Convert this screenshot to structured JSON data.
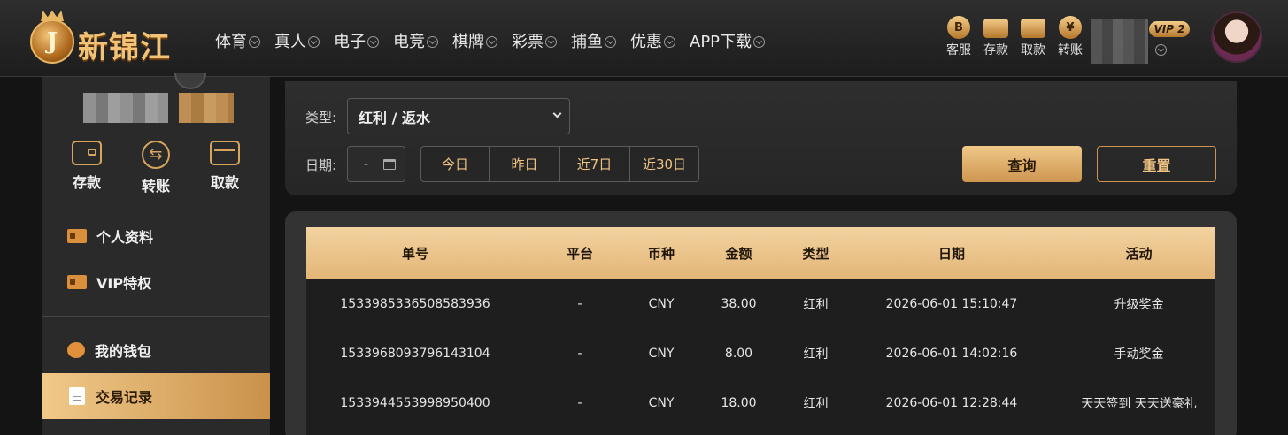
{
  "header": {
    "logo_text": "新锦江",
    "logo_letter": "J",
    "nav": [
      "体育",
      "真人",
      "电子",
      "电竞",
      "棋牌",
      "彩票",
      "捕鱼",
      "优惠",
      "APP下载"
    ],
    "quick_actions": [
      {
        "label": "客服",
        "icon": "customer-service-icon",
        "glyph": "B"
      },
      {
        "label": "存款",
        "icon": "wallet-icon",
        "glyph": ""
      },
      {
        "label": "取款",
        "icon": "withdraw-icon",
        "glyph": ""
      },
      {
        "label": "转账",
        "icon": "transfer-icon",
        "glyph": "¥"
      }
    ],
    "vip": "VIP 2"
  },
  "sidebar": {
    "actions": [
      {
        "label": "存款",
        "icon": "wallet-icon"
      },
      {
        "label": "转账",
        "icon": "transfer-icon"
      },
      {
        "label": "取款",
        "icon": "card-icon"
      }
    ],
    "menu_top": [
      "个人资料",
      "VIP特权"
    ],
    "menu_bottom": [
      "我的钱包",
      "交易记录"
    ],
    "active": "交易记录"
  },
  "filter": {
    "type_label": "类型:",
    "type_value": "红利 / 返水",
    "date_label": "日期:",
    "date_sep": "-",
    "quick_dates": [
      "今日",
      "昨日",
      "近7日",
      "近30日"
    ],
    "query_btn": "查询",
    "reset_btn": "重置"
  },
  "table": {
    "headers": [
      "单号",
      "平台",
      "币种",
      "金额",
      "类型",
      "日期",
      "活动"
    ],
    "rows": [
      [
        "1533985336508583936",
        "-",
        "CNY",
        "38.00",
        "红利",
        "2026-06-01 15:10:47",
        "升级奖金"
      ],
      [
        "1533968093796143104",
        "-",
        "CNY",
        "8.00",
        "红利",
        "2026-06-01 14:02:16",
        "手动奖金"
      ],
      [
        "1533944553998950400",
        "-",
        "CNY",
        "18.00",
        "红利",
        "2026-06-01 12:28:44",
        "天天签到 天天送豪礼"
      ]
    ]
  },
  "colors": {
    "accent_gold": "#e3b577",
    "background": "#141414",
    "panel": "#333333"
  }
}
